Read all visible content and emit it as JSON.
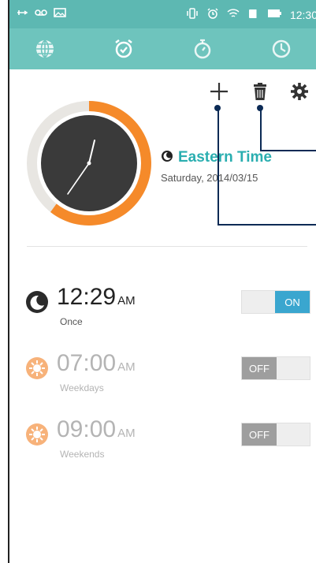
{
  "status_bar": {
    "time": "12:30"
  },
  "tabs": [
    {
      "name": "world-clock"
    },
    {
      "name": "alarm"
    },
    {
      "name": "stopwatch"
    },
    {
      "name": "timer"
    }
  ],
  "clock": {
    "city": "Eastern Time",
    "date": "Saturday, 2014/03/15"
  },
  "alarms": [
    {
      "time": "12:29",
      "ampm": "AM",
      "repeat": "Once",
      "toggle": "ON",
      "icon": "moon-icon"
    },
    {
      "time": "07:00",
      "ampm": "AM",
      "repeat": "Weekdays",
      "toggle": "OFF",
      "icon": "sun-icon"
    },
    {
      "time": "09:00",
      "ampm": "AM",
      "repeat": "Weekends",
      "toggle": "OFF",
      "icon": "sun-icon"
    }
  ],
  "colors": {
    "header": "#5db8b2",
    "accent": "#2aaeb0",
    "ring": "#f58a2a",
    "toggle_on": "#3aa6cf"
  }
}
